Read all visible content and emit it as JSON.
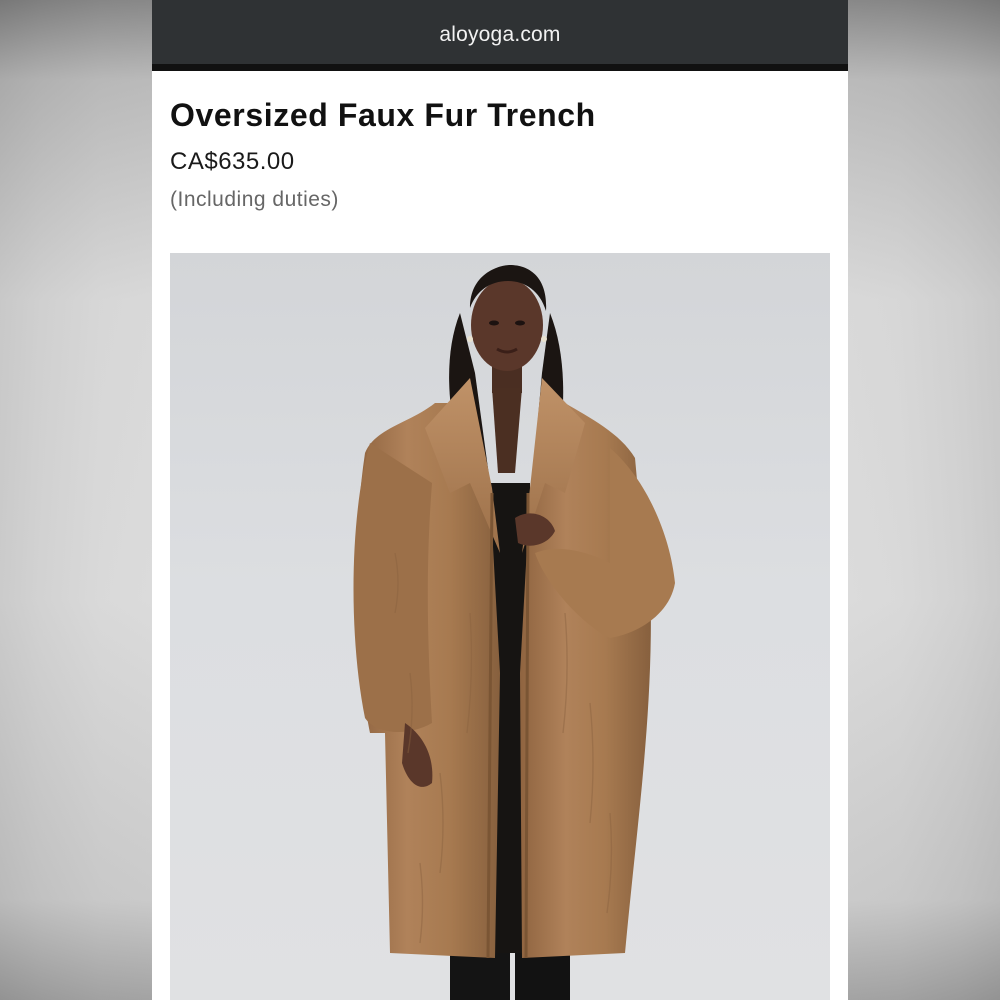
{
  "browser": {
    "url": "aloyoga.com"
  },
  "product": {
    "title": "Oversized Faux Fur Trench",
    "price": "CA$635.00",
    "price_note": "(Including duties)",
    "image_icon": "product-photo-model-in-camel-faux-fur-coat"
  },
  "colors": {
    "url_bar": "#2f3234",
    "coat": "#a87a4f",
    "photo_background": "#dcdee1"
  }
}
